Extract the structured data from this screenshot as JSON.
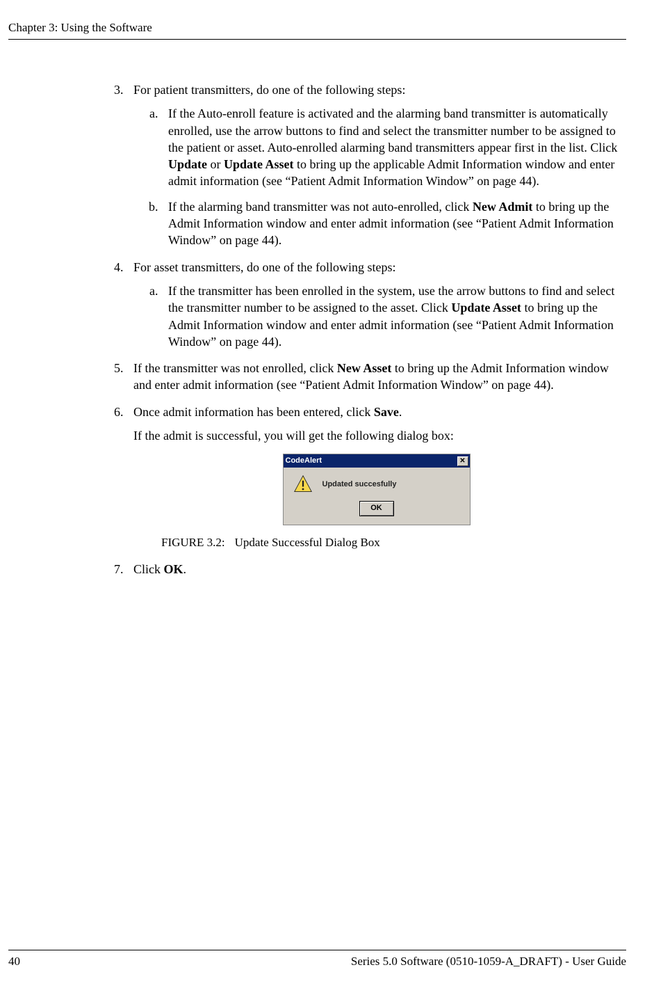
{
  "header": {
    "chapter": "Chapter 3: Using the Software"
  },
  "list": {
    "item3": {
      "num": "3.",
      "text": "For patient transmitters, do one of the following steps:",
      "a_num": "a.",
      "a_pre": "If the Auto-enroll feature is activated and the alarming band transmitter is automatically enrolled, use the arrow buttons to find and select the transmitter number to be assigned to the patient or asset. Auto-enrolled alarming band transmitters appear first in the list. Click ",
      "a_b1": "Update",
      "a_mid": " or ",
      "a_b2": "Update Asset",
      "a_post": " to bring up the applicable Admit Information window and enter admit information (see “Patient Admit Information Window” on page 44).",
      "b_num": "b.",
      "b_pre": "If the alarming band transmitter was not auto-enrolled, click ",
      "b_b1": "New Admit",
      "b_post": " to bring up the Admit Information window and enter admit information (see “Patient Admit Information Window” on page 44)."
    },
    "item4": {
      "num": "4.",
      "text": "For asset transmitters, do one of the following steps:",
      "a_num": "a.",
      "a_pre": "If the transmitter has been enrolled in the system, use the arrow buttons to find and select the transmitter number to be assigned to the asset. Click ",
      "a_b1": "Update Asset",
      "a_post": " to bring up the Admit Information window and enter admit information (see “Patient Admit Information Window” on page 44)."
    },
    "item5": {
      "num": "5.",
      "pre": "If the transmitter was not enrolled, click ",
      "b1": "New Asset",
      "post": " to bring up the Admit Information window and enter admit information (see “Patient Admit Information Window” on page 44)."
    },
    "item6": {
      "num": "6.",
      "pre": "Once admit information has been entered, click ",
      "b1": "Save",
      "post": ".",
      "follow": "If the admit is successful, you will get the following dialog box:"
    },
    "item7": {
      "num": "7.",
      "pre": "Click ",
      "b1": "OK",
      "post": "."
    }
  },
  "dialog": {
    "title": "CodeAlert",
    "close": "✕",
    "message": "Updated succesfully",
    "ok": "OK"
  },
  "figure": {
    "label": "FIGURE 3.2:",
    "caption": "Update Successful Dialog Box"
  },
  "footer": {
    "page": "40",
    "right": "Series 5.0 Software (0510-1059-A_DRAFT) - User Guide"
  }
}
